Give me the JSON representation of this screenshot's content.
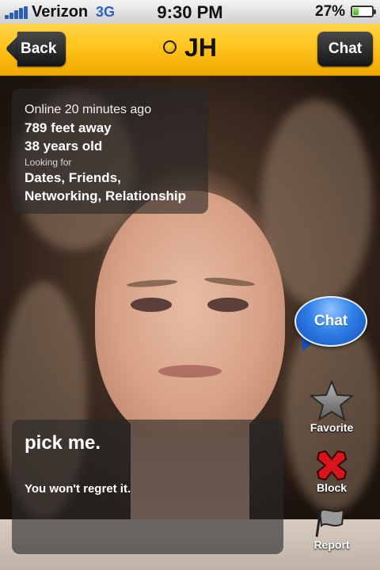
{
  "status_bar": {
    "carrier": "Verizon",
    "network": "3G",
    "time": "9:30 PM",
    "battery_percent": "27%",
    "battery_level": 0.27
  },
  "nav": {
    "back_label": "Back",
    "title": "JH",
    "chat_label": "Chat",
    "status_dot_color": "#f0b400"
  },
  "profile": {
    "last_online": "Online 20 minutes ago",
    "distance": "789 feet away",
    "age": "38 years old",
    "looking_for_label": "Looking for",
    "looking_for_line1": "Dates, Friends,",
    "looking_for_line2": "Networking, Relationship",
    "headline": "pick me.",
    "about": "You won't regret it."
  },
  "actions": {
    "chat_label": "Chat",
    "favorite_label": "Favorite",
    "block_label": "Block",
    "report_label": "Report"
  },
  "colors": {
    "nav_yellow": "#ffc41c",
    "chat_blue": "#2f7fe8",
    "block_red": "#d8141c"
  }
}
